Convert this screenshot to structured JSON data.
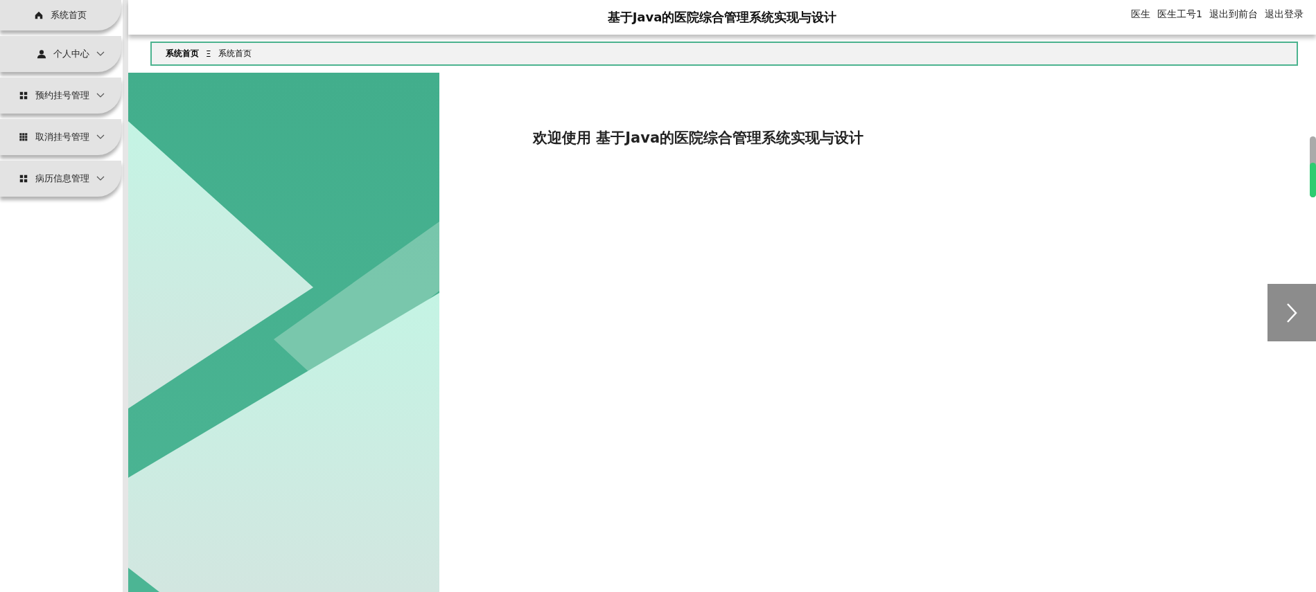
{
  "sidebar": {
    "items": [
      {
        "label": "系统首页",
        "kind": "home",
        "expandable": false
      },
      {
        "label": "个人中心",
        "kind": "user",
        "expandable": true
      },
      {
        "label": "预约挂号管理",
        "kind": "grid",
        "expandable": true
      },
      {
        "label": "取消挂号管理",
        "kind": "table",
        "expandable": true
      },
      {
        "label": "病历信息管理",
        "kind": "grid",
        "expandable": true
      }
    ]
  },
  "header": {
    "title": "基于Java的医院综合管理系统实现与设计",
    "user_role": "医生",
    "user_name": "医生工号1",
    "links": [
      "退出到前台",
      "退出登录"
    ]
  },
  "breadcrumb": {
    "items": [
      "系统首页",
      "系统首页"
    ],
    "separator": "Ξ"
  },
  "welcome": {
    "title": "欢迎使用 基于Java的医院综合管理系统实现与设计"
  }
}
